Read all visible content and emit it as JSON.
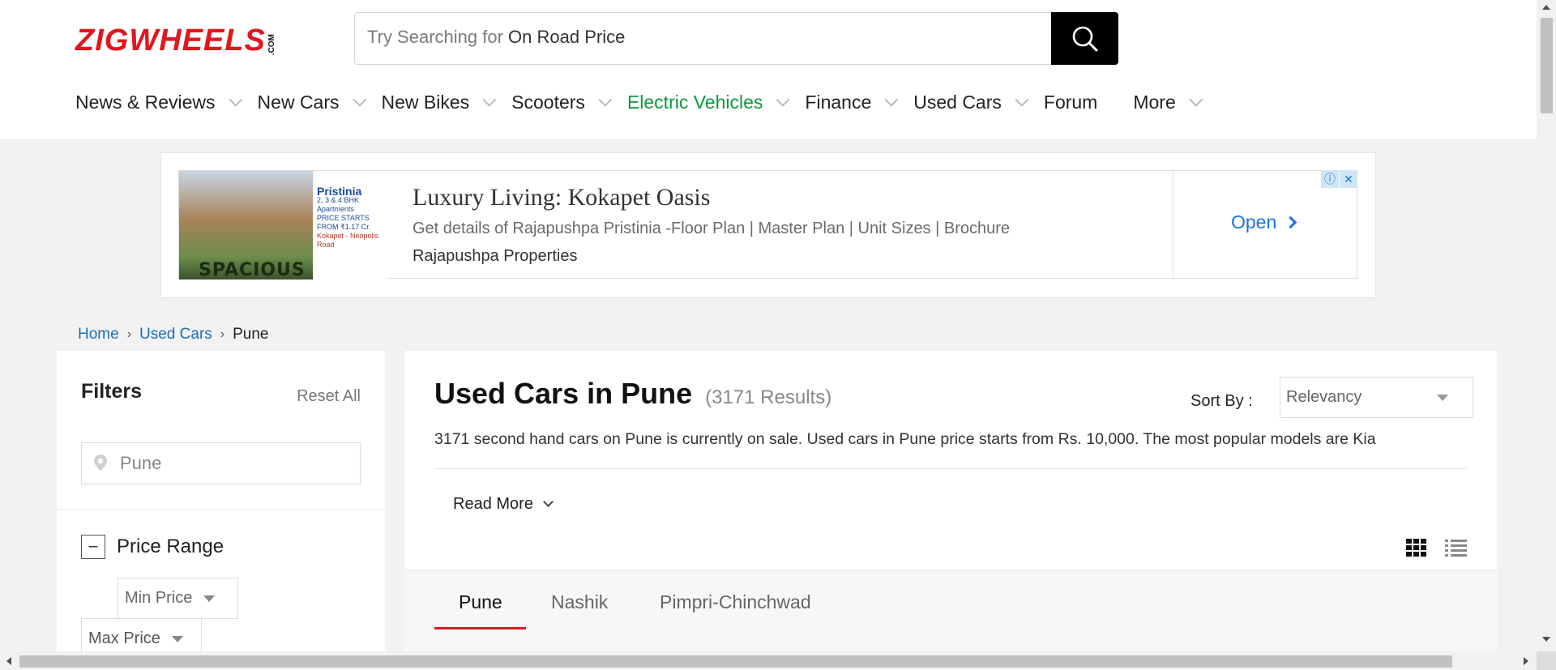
{
  "header": {
    "logo_text": "ZIGWHEELS",
    "logo_suffix": ".COM",
    "search": {
      "placeholder": "Try Searching for",
      "suggestion": "On Road Price",
      "icon": "search-icon"
    },
    "nav": [
      {
        "label": "News & Reviews",
        "has_dropdown": true
      },
      {
        "label": "New Cars",
        "has_dropdown": true
      },
      {
        "label": "New Bikes",
        "has_dropdown": true
      },
      {
        "label": "Scooters",
        "has_dropdown": true
      },
      {
        "label": "Electric Vehicles",
        "has_dropdown": true,
        "color": "#0a9a3c"
      },
      {
        "label": "Finance",
        "has_dropdown": true
      },
      {
        "label": "Used Cars",
        "has_dropdown": true
      },
      {
        "label": "Forum",
        "has_dropdown": false
      },
      {
        "label": "More",
        "has_dropdown": true
      }
    ]
  },
  "ad": {
    "image_heading": "Pristinia",
    "image_lines": [
      "2, 3 & 4 BHK",
      "Apartments",
      "PRICE STARTS",
      "FROM ₹1.17 Cr.",
      "Kokapet - Neopolis Road"
    ],
    "image_caption": "SPACIOUS",
    "title": "Luxury Living: Kokapet Oasis",
    "description": "Get details of Rajapushpa Pristinia -Floor Plan | Master Plan | Unit Sizes | Brochure",
    "advertiser": "Rajapushpa Properties",
    "cta": "Open",
    "info_icon": "ⓘ",
    "close_icon": "✕"
  },
  "breadcrumb": {
    "items": [
      "Home",
      "Used Cars"
    ],
    "current": "Pune"
  },
  "filters": {
    "title": "Filters",
    "reset": "Reset All",
    "city_value": "Pune",
    "price_range": {
      "title": "Price Range",
      "toggle": "−",
      "min_label": "Min Price",
      "max_label": "Max Price"
    }
  },
  "main": {
    "title": "Used Cars in Pune",
    "count": "(3171 Results)",
    "sort_label": "Sort By :",
    "sort_value": "Relevancy",
    "description": "3171 second hand cars on Pune is currently on sale. Used cars in Pune price starts from Rs. 10,000. The most popular models are Kia",
    "read_more": "Read More",
    "tabs": [
      {
        "label": "Pune",
        "active": true
      },
      {
        "label": "Nashik",
        "active": false
      },
      {
        "label": "Pimpri-Chinchwad",
        "active": false
      }
    ]
  },
  "colors": {
    "brand_red": "#e1171e",
    "ev_green": "#0a9a3c",
    "link_blue": "#1c6fb8",
    "ad_blue": "#1a73e8"
  }
}
